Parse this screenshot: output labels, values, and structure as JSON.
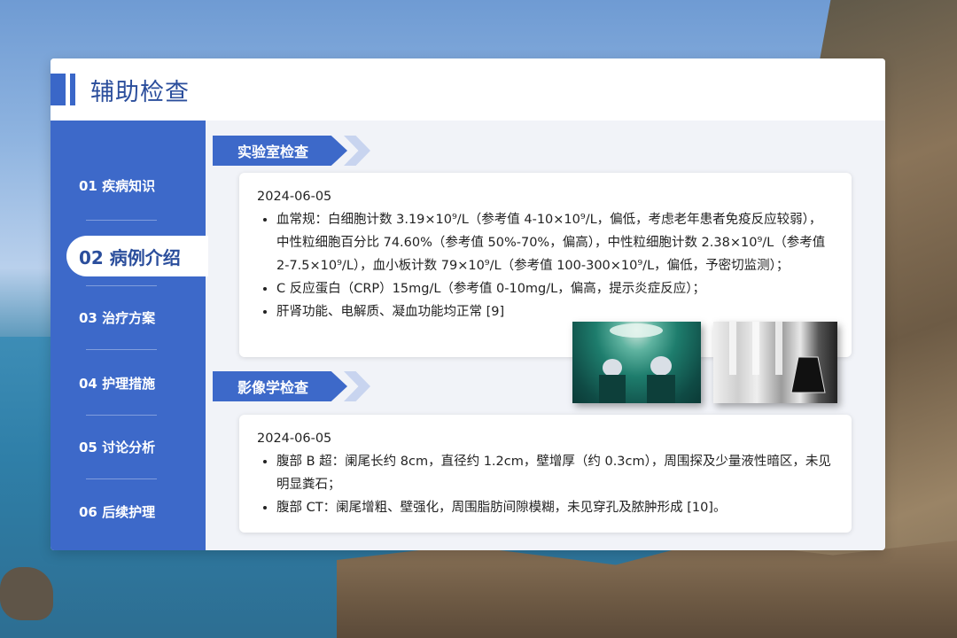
{
  "header": {
    "title": "辅助检查"
  },
  "sidebar": {
    "items": [
      {
        "label": "01 疾病知识"
      },
      {
        "label": "02 病例介绍",
        "active": true
      },
      {
        "label": "03 治疗方案"
      },
      {
        "label": "04 护理措施"
      },
      {
        "label": "05 讨论分析"
      },
      {
        "label": "06 后续护理"
      }
    ]
  },
  "lab": {
    "heading": "实验室检查",
    "date": "2024-06-05",
    "items": [
      "血常规：白细胞计数 3.19×10⁹/L（参考值 4-10×10⁹/L，偏低，考虑老年患者免疫反应较弱），中性粒细胞百分比 74.60%（参考值 50%-70%，偏高），中性粒细胞计数 2.38×10⁹/L（参考值 2-7.5×10⁹/L），血小板计数 79×10⁹/L（参考值 100-300×10⁹/L，偏低，予密切监测）；",
      "C 反应蛋白（CRP）15mg/L（参考值 0-10mg/L，偏高，提示炎症反应）；",
      "肝肾功能、电解质、凝血功能均正常 [9]"
    ]
  },
  "imaging": {
    "heading": "影像学检查",
    "date": "2024-06-05",
    "items": [
      "腹部 B 超：阑尾长约 8cm，直径约 1.2cm，壁增厚（约 0.3cm），周围探及少量液性暗区，未见明显粪石；",
      "腹部 CT：阑尾增粗、壁强化，周围脂肪间隙模糊，未见穿孔及脓肿形成 [10]。"
    ]
  },
  "photos": {
    "surgery_icon": "surgery-photo",
    "lab_icon": "lab-photo"
  },
  "colors": {
    "accent": "#3d69c9",
    "title": "#2b4e9c"
  }
}
